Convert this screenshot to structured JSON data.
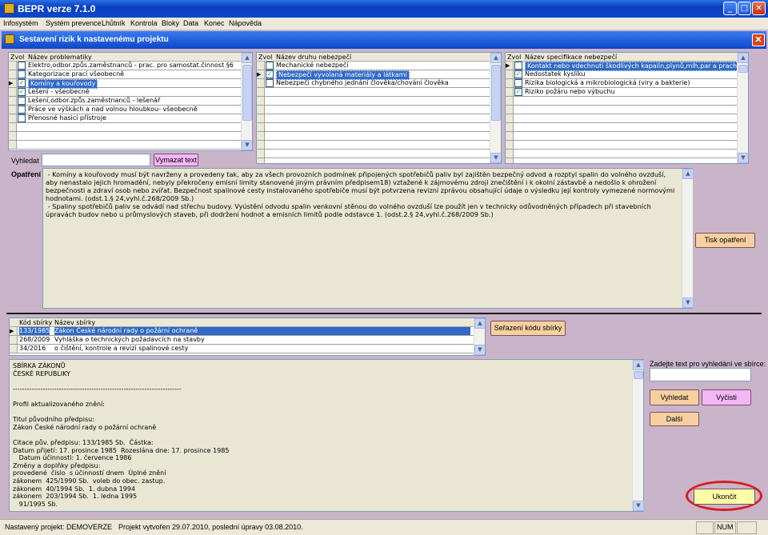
{
  "window": {
    "title": "BEPR verze 7.1.0"
  },
  "menu": [
    "Infosystém",
    "Systém prevence",
    "Lhůtník",
    "Kontrola",
    "Bloky",
    "Data",
    "Konec",
    "Nápověda"
  ],
  "child_window": {
    "title": "Sestavení rizik k nastavenému projektu"
  },
  "grid1": {
    "headers": {
      "col1": "Zvol",
      "col2": "Název problematiky"
    },
    "rows": [
      {
        "text": "Elektro,odbor.způs.zaměstnanců - prac. pro samostat.činnost §6",
        "checked": false
      },
      {
        "text": "Kategorizace prací všeobecně",
        "checked": false
      },
      {
        "text": "Komíny a kouřovody",
        "checked": true,
        "selected": true
      },
      {
        "text": "Lešení - všeobecně",
        "checked": true
      },
      {
        "text": "Lešení,odbor.způs.zaměstnanců - lešenář",
        "checked": false
      },
      {
        "text": "Práce ve výškách a nad volnou hloubkou- všeobecně",
        "checked": false
      },
      {
        "text": "Přenosné hasicí přístroje",
        "checked": false
      }
    ]
  },
  "grid2": {
    "headers": {
      "col1": "Zvol",
      "col2": "Název druhu nebezpečí"
    },
    "rows": [
      {
        "text": "Mechanické nebezpečí",
        "checked": false
      },
      {
        "text": "Nebezpečí vyvolaná materiály a látkami",
        "checked": true,
        "selected": true
      },
      {
        "text": "Nebezpečí chybného jednání člověka/chování člověka",
        "checked": false
      }
    ]
  },
  "grid3": {
    "headers": {
      "col1": "Zvol",
      "col2": "Název specifikace nebezpečí"
    },
    "rows": [
      {
        "text": "Kontakt nebo vdechnutí škodlivých kapalin,plynů,mlh,par a prachů",
        "checked": false,
        "selected": true
      },
      {
        "text": "Nedostatek kyslíku",
        "checked": true
      },
      {
        "text": "Rizika biologická a mikrobiologická (viry a bakterie)",
        "checked": false
      },
      {
        "text": "Riziko požáru nebo výbuchu",
        "checked": true
      }
    ]
  },
  "search": {
    "label": "Vyhledat",
    "value": "",
    "clear_button": "Vymazat text"
  },
  "measures": {
    "label": "Opatření",
    "text": " - Komíny a kouřovody musí být navrženy a provedeny tak, aby za všech provozních podmínek připojených spotřebičů paliv byl zajištěn bezpečný odvod a rozptyl spalin do volného ovzduší, aby nenastalo jejich hromadění, nebyly překročeny emisní limity stanovené jiným právním předpisem18) vztažené k zájmovému zdroji znečištění i k okolní zástavbě a nedošlo k ohrožení bezpečnosti a zdraví osob nebo zvířat. Bezpečnost spalinové cesty instalovaného spotřebiče musí být potvrzena revizní zprávou obsahující údaje o výsledku její kontroly vymezené normovými hodnotami. (odst.1.§ 24,vyhl.č.268/2009 Sb.)\n - Spaliny spotřebičů paliv se odvádí nad střechu budovy. Vyústění odvodu spalin venkovní stěnou do volného ovzduší lze použít jen v technicky odůvodněných případech při stavebních úpravách budov nebo u průmyslových staveb, při dodržení hodnot a emisních limitů podle odstavce 1. (odst.2.§ 24,vyhl.č.268/2009 Sb.)",
    "print_button": "Tisk opatření"
  },
  "laws": {
    "headers": {
      "code": "Kód sbírky",
      "name": "Název sbírky"
    },
    "rows": [
      {
        "code": "133/1985",
        "name": "Zákon České národní rady o požární ochraně",
        "selected": true
      },
      {
        "code": "268/2009",
        "name": "Vyhláška o technických požadavcích na stavby"
      },
      {
        "code": "34/2016",
        "name": "o čištění, kontrole a revizi spalinové cesty"
      }
    ],
    "sort_button": "Seřazení kódu sbírky"
  },
  "law_text": [
    "SBÍRKA ZÁKONŮ",
    "ČESKÉ REPUBLIKY",
    "",
    "-------------------------------------------------------------------------",
    "",
    "Profil aktualizovaného znění:",
    "",
    "Titul původního předpisu:",
    "Zákon České národní rady o požární ochraně",
    "",
    "Citace pův. předpisu: 133/1985 Sb.  Částka:",
    "Datum přijetí: 17. prosince 1985  Rozeslána dne: 17. prosince 1985",
    "   Datum účinnosti: 1. července 1986",
    "Změny a doplňky předpisu:",
    "provedené  číslo  s účinností dnem  Úplné znění",
    "zákonem  425/1990 Sb.  voleb do obec. zastup.",
    "zákonem  40/1994 Sb.  1. dubna 1994",
    "zákonem  203/1994 Sb.  1. ledna 1995",
    "   91/1995 Sb."
  ],
  "law_search": {
    "label": "Zadejte text pro vyhledání ve sbírce:",
    "value": "",
    "find_button": "Vyhledat",
    "clear_button": "Vyčisti",
    "next_button": "Další"
  },
  "exit_button": "Ukončit",
  "status": {
    "project": "Nastavený projekt: DEMOVERZE",
    "created": "Projekt vytvořen 29.07.2010, poslední úpravy 03.08.2010.",
    "num": "NUM"
  },
  "colors": {
    "title_blue": "#0a3fbf",
    "selection": "#316ac5",
    "background": "#c9b4ca",
    "pink_button": "#f4b6f7",
    "orange_button": "#f6d0a0",
    "yellow_button": "#ffffa8",
    "highlight_ring": "#d42020"
  }
}
